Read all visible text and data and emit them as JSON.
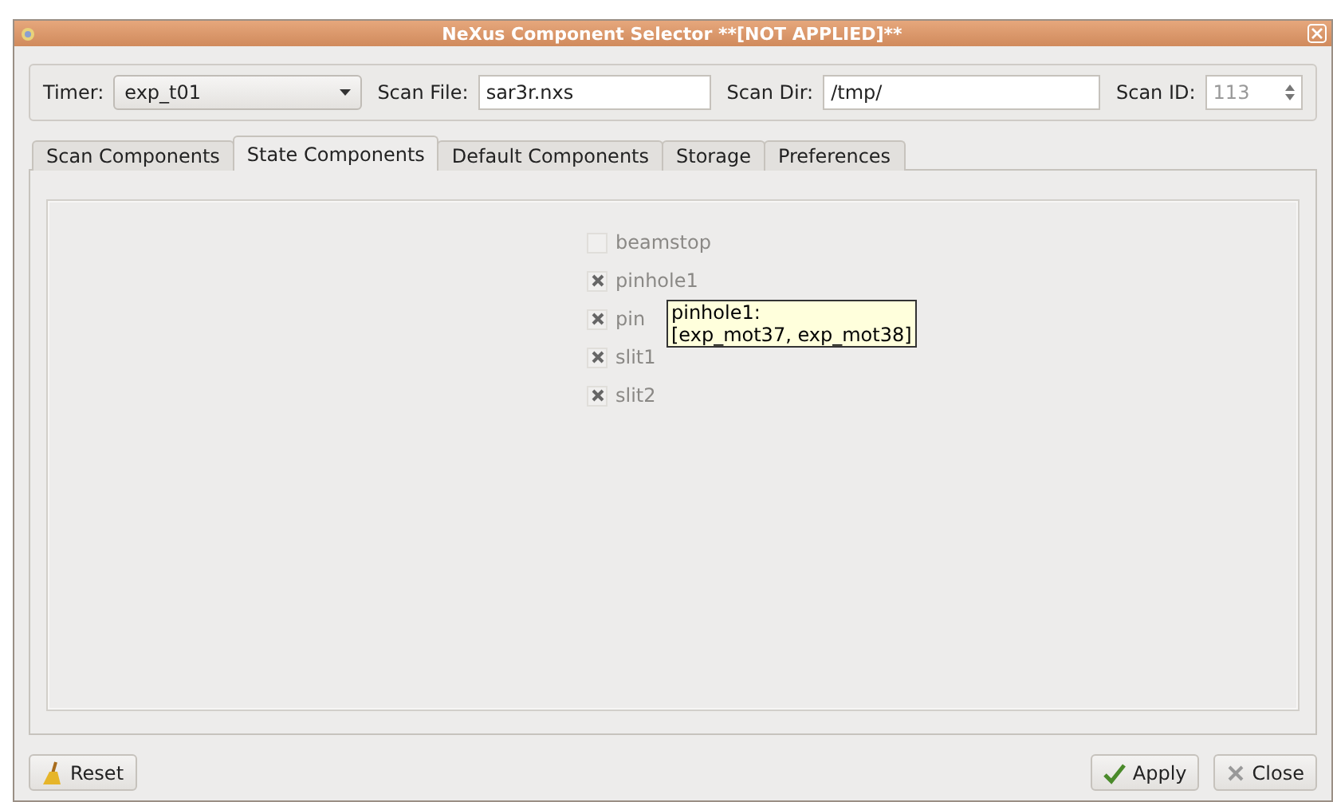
{
  "window": {
    "title": "NeXus Component Selector **[NOT APPLIED]**"
  },
  "toolbar": {
    "timer": {
      "label": "Timer:",
      "value": "exp_t01"
    },
    "scan_file": {
      "label": "Scan File:",
      "value": "sar3r.nxs"
    },
    "scan_dir": {
      "label": "Scan Dir:",
      "value": "/tmp/"
    },
    "scan_id": {
      "label": "Scan ID:",
      "value": "113"
    }
  },
  "tabs": [
    {
      "label": "Scan Components",
      "selected": false
    },
    {
      "label": "State Components",
      "selected": true
    },
    {
      "label": "Default Components",
      "selected": false
    },
    {
      "label": "Storage",
      "selected": false
    },
    {
      "label": "Preferences",
      "selected": false
    }
  ],
  "components": [
    {
      "label": "beamstop",
      "checked": false
    },
    {
      "label": "pinhole1",
      "checked": true
    },
    {
      "label": "pin",
      "checked": true
    },
    {
      "label": "slit1",
      "checked": true
    },
    {
      "label": "slit2",
      "checked": true
    }
  ],
  "tooltip": {
    "lines": [
      "pinhole1:",
      "[exp_mot37, exp_mot38]"
    ]
  },
  "buttons": {
    "reset": "Reset",
    "apply": "Apply",
    "close": "Close"
  }
}
